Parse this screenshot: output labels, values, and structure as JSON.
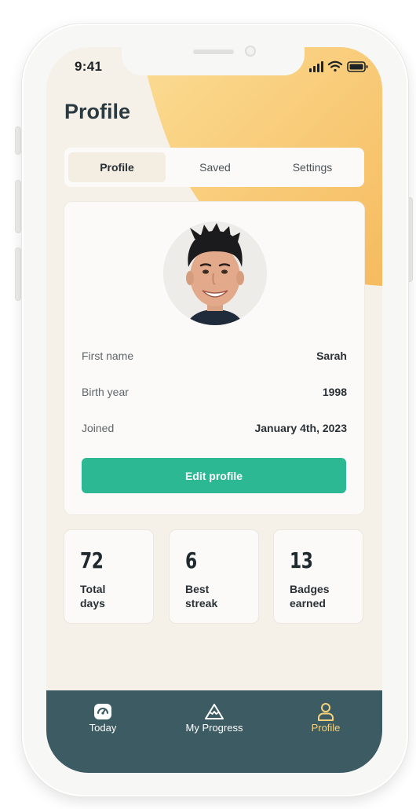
{
  "status_bar": {
    "time": "9:41"
  },
  "page": {
    "title": "Profile"
  },
  "tabs": [
    {
      "label": "Profile",
      "active": true
    },
    {
      "label": "Saved",
      "active": false
    },
    {
      "label": "Settings",
      "active": false
    }
  ],
  "profile": {
    "rows": [
      {
        "label": "First name",
        "value": "Sarah"
      },
      {
        "label": "Birth year",
        "value": "1998"
      },
      {
        "label": "Joined",
        "value": "January 4th, 2023"
      }
    ],
    "edit_button": "Edit profile"
  },
  "stats": [
    {
      "value": "72",
      "label": "Total\ndays"
    },
    {
      "value": "6",
      "label": "Best\nstreak"
    },
    {
      "value": "13",
      "label": "Badges\nearned"
    }
  ],
  "nav": [
    {
      "label": "Today",
      "icon": "gauge-icon",
      "active": false
    },
    {
      "label": "My Progress",
      "icon": "mountain-icon",
      "active": false
    },
    {
      "label": "Profile",
      "icon": "person-icon",
      "active": true
    }
  ],
  "colors": {
    "accent_green": "#2bb893",
    "nav_bg": "#3d5b63",
    "nav_active": "#f6d27a",
    "screen_bg": "#f6f1e8",
    "blob_orange": "#f7c46a"
  }
}
